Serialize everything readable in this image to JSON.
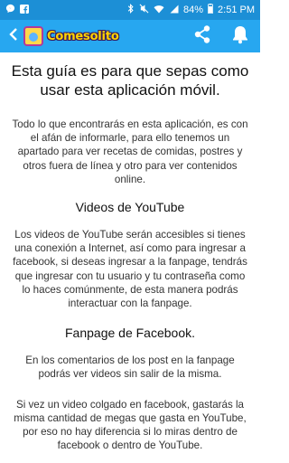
{
  "status_bar": {
    "battery_percent": "84%",
    "time": "2:51 PM"
  },
  "app_bar": {
    "title": "Comesolito"
  },
  "content": {
    "heading": "Esta guía es para que sepas como usar esta aplicación móvil.",
    "intro": "Todo lo que encontrarás en esta aplicación, es con el afán de informarle, para ello tenemos un apartado para ver recetas de comidas, postres y otros fuera de línea y otro para ver contenidos online.",
    "youtube_heading": "Videos de YouTube",
    "youtube_text": "Los videos de YouTube serán accesibles si tienes una conexión a Internet, así como para ingresar a facebook, si deseas ingresar a la fanpage, tendrás que ingresar con tu usuario y tu contraseña como lo haces comúnmente, de esta manera podrás interactuar con la fanpage.",
    "facebook_heading": "Fanpage de Facebook.",
    "facebook_text": "En los comentarios de los post en la fanpage podrás ver videos sin salir de la misma.",
    "closing_text": "Si vez un video colgado en facebook, gastarás la misma cantidad de megas que gasta en YouTube, por eso no hay diferencia si lo miras dentro de facebook o dentro de YouTube."
  }
}
